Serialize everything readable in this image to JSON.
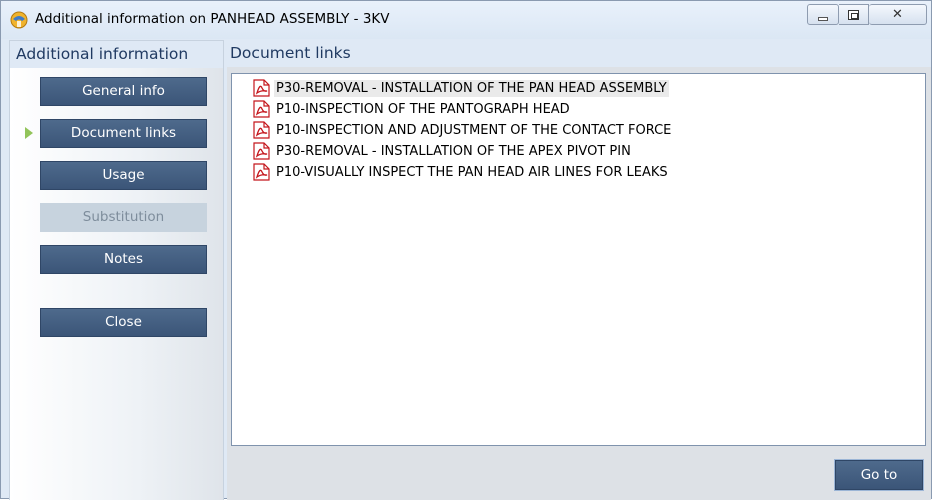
{
  "window": {
    "title": "Additional information on PANHEAD ASSEMBLY - 3KV",
    "controls": {
      "minimize": "minimize",
      "maximize": "maximize",
      "close": "close"
    }
  },
  "left": {
    "header": "Additional information",
    "buttons": [
      {
        "label": "General info",
        "enabled": true,
        "active": false
      },
      {
        "label": "Document links",
        "enabled": true,
        "active": true
      },
      {
        "label": "Usage",
        "enabled": true,
        "active": false
      },
      {
        "label": "Substitution",
        "enabled": false,
        "active": false
      },
      {
        "label": "Notes",
        "enabled": true,
        "active": false
      }
    ],
    "close_label": "Close"
  },
  "right": {
    "header": "Document links",
    "documents": [
      {
        "label": "P30-REMOVAL - INSTALLATION OF THE PAN HEAD ASSEMBLY",
        "icon": "pdf-icon",
        "selected": true
      },
      {
        "label": "P10-INSPECTION OF THE PANTOGRAPH HEAD",
        "icon": "pdf-icon",
        "selected": false
      },
      {
        "label": "P10-INSPECTION AND ADJUSTMENT OF THE CONTACT FORCE",
        "icon": "pdf-icon",
        "selected": false
      },
      {
        "label": "P30-REMOVAL - INSTALLATION OF THE APEX PIVOT PIN",
        "icon": "pdf-icon",
        "selected": false
      },
      {
        "label": "P10-VISUALLY INSPECT THE PAN HEAD AIR LINES FOR LEAKS",
        "icon": "pdf-icon",
        "selected": false
      }
    ],
    "goto_label": "Go to"
  },
  "colors": {
    "button_fill": "#3b5578",
    "header_text": "#203a62",
    "active_arrow": "#92c45a",
    "pdf_red": "#c4161c"
  }
}
